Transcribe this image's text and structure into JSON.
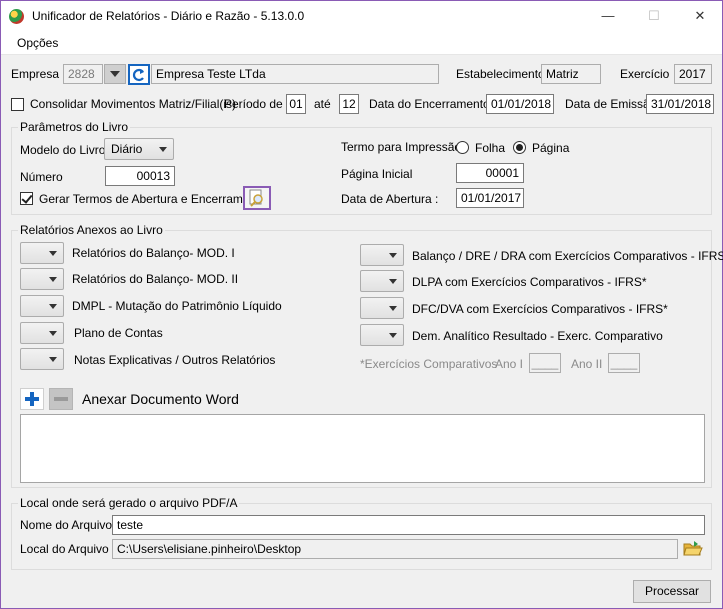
{
  "window": {
    "title": "Unificador de Relatórios - Diário e Razão - 5.13.0.0"
  },
  "menu": {
    "options": "Opções"
  },
  "header": {
    "empresa_label": "Empresa",
    "empresa_code": "2828",
    "empresa_name": "Empresa Teste LTda",
    "estabelecimento_label": "Estabelecimento",
    "estabelecimento_value": "Matriz",
    "exercicio_label": "Exercício",
    "exercicio_value": "2017",
    "consolidar_label": "Consolidar Movimentos Matriz/Filial(is)",
    "periodo_label": "Período de",
    "periodo_from": "01",
    "ate_label": "até",
    "periodo_to": "12",
    "data_encerramento_label": "Data do Encerramento",
    "data_encerramento_value": "01/01/2018",
    "data_emissao_label": "Data de Emissão",
    "data_emissao_value": "31/01/2018"
  },
  "parametros": {
    "legend": "Parâmetros do Livro",
    "modelo_label": "Modelo do Livro",
    "modelo_value": "Diário",
    "numero_label": "Número",
    "numero_value": "00013",
    "gerar_termos_label": "Gerar Termos de Abertura e Encerramento",
    "termo_label": "Termo para Impressão",
    "opt_folha": "Folha",
    "opt_pagina": "Página",
    "pagina_inicial_label": "Página Inicial",
    "pagina_inicial_value": "00001",
    "data_abertura_label": "Data de Abertura :",
    "data_abertura_value": "01/01/2017"
  },
  "relatorios": {
    "legend": "Relatórios Anexos ao Livro",
    "left": [
      "Relatórios do Balanço- MOD. I",
      "Relatórios do Balanço- MOD. II",
      "DMPL - Mutação do Patrimônio Líquido",
      "Plano de Contas",
      "Notas Explicativas / Outros Relatórios"
    ],
    "right": [
      "Balanço / DRE / DRA com Exercícios Comparativos - IFRS*",
      "DLPA com Exercícios Comparativos - IFRS*",
      "DFC/DVA com Exercícios Comparativos - IFRS*",
      "Dem. Analítico Resultado - Exerc. Comparativo"
    ],
    "exercicios_label": "*Exercícios Comparativos",
    "ano1_label": "Ano I",
    "ano1_value": "____",
    "ano2_label": "Ano II",
    "ano2_value": "____",
    "anexar_label": "Anexar Documento Word"
  },
  "local": {
    "legend": "Local onde será gerado o arquivo PDF/A",
    "nome_label": "Nome do Arquivo",
    "nome_value": "teste",
    "local_label": "Local do Arquivo",
    "local_value": "C:\\Users\\elisiane.pinheiro\\Desktop"
  },
  "footer": {
    "processar": "Processar"
  },
  "colors": {
    "accent": "#8a5bb5",
    "blue": "#1565c0",
    "folder": "#e7b43b"
  }
}
